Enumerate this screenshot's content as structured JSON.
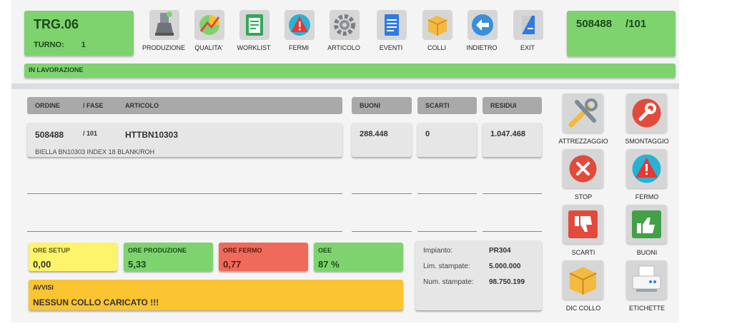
{
  "station": {
    "title": "TRG.06",
    "turno_label": "TURNO:",
    "turno_value": "1"
  },
  "order_card": {
    "order": "508488",
    "phase": "/101"
  },
  "status": {
    "text": "IN LAVORAZIONE"
  },
  "toolbar": [
    {
      "label": "PRODUZIONE",
      "icon": "factory-icon"
    },
    {
      "label": "QUALITA'",
      "icon": "quality-chart-icon"
    },
    {
      "label": "WORKLIST",
      "icon": "clipboard-icon"
    },
    {
      "label": "FERMI",
      "icon": "warning-icon"
    },
    {
      "label": "ARTICOLO",
      "icon": "gear-icon"
    },
    {
      "label": "EVENTI",
      "icon": "document-icon"
    },
    {
      "label": "COLLI",
      "icon": "box-icon"
    },
    {
      "label": "INDIETRO",
      "icon": "back-arrow-icon"
    },
    {
      "label": "EXIT",
      "icon": "exit-icon"
    }
  ],
  "table": {
    "headers": {
      "ordine": "ORDINE",
      "fase": "/ FASE",
      "articolo": "ARTICOLO",
      "buoni": "BUONI",
      "scarti": "SCARTI",
      "residui": "RESIDUI"
    },
    "row": {
      "ordine": "508488",
      "fase": "/ 101",
      "articolo": "HTTBN10303",
      "descrizione": "BIELLA BN10303 INDEX 18 BLANK/ROH",
      "buoni": "288.448",
      "scarti": "0",
      "residui": "1.047.468"
    }
  },
  "kpis": {
    "setup": {
      "label": "ORE SETUP",
      "value": "0,00",
      "color": "#fdf46b"
    },
    "produzione": {
      "label": "ORE PRODUZIONE",
      "value": "5,33",
      "color": "#7ed36f"
    },
    "fermo": {
      "label": "ORE FERMO",
      "value": "0,77",
      "color": "#ef6a5a"
    },
    "oee": {
      "label": "OEE",
      "value": "87 %",
      "color": "#7ed36f"
    }
  },
  "avvisi": {
    "title": "AVVISI",
    "message": "NESSUN COLLO CARICATO !!!"
  },
  "info": {
    "impianto_label": "Impianto:",
    "impianto_value": "PR304",
    "lim_label": "Lim. stampate:",
    "lim_value": "5.000.000",
    "num_label": "Num. stampate:",
    "num_value": "98.750.199"
  },
  "side_buttons": {
    "attrezzaggio": "ATTREZZAGGIO",
    "smontaggio": "SMONTAGGIO",
    "stop": "STOP",
    "fermo": "FERMO",
    "scarti": "SCARTI",
    "buoni": "BUONI",
    "dic_collo": "DIC COLLO",
    "etichette": "ETICHETTE"
  }
}
